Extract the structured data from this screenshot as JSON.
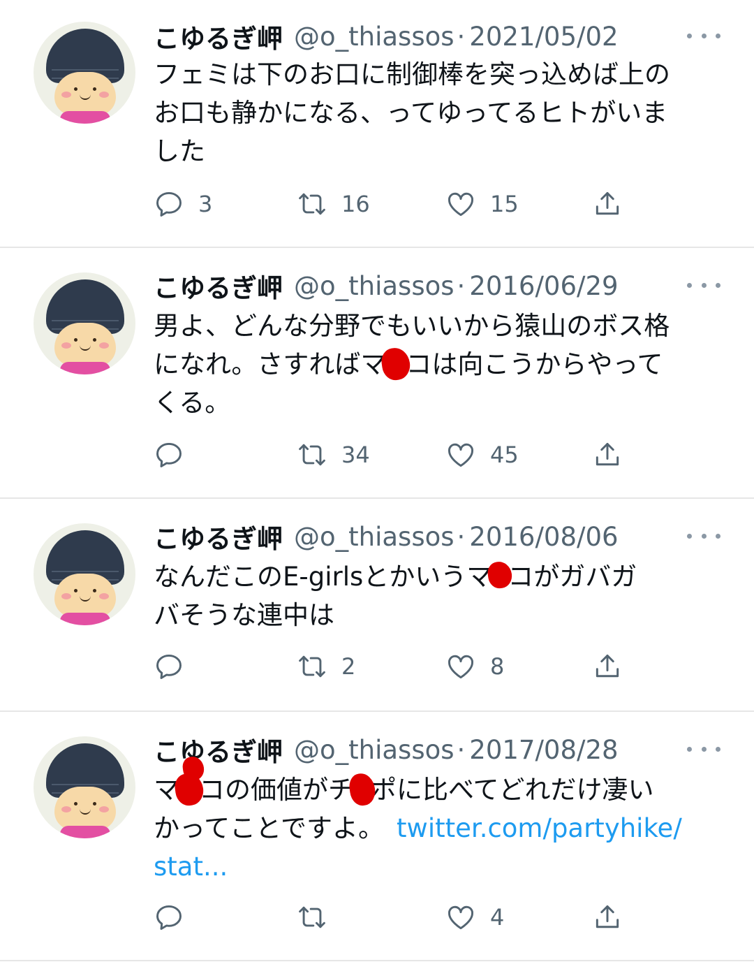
{
  "tweets": [
    {
      "name": "こゆるぎ岬",
      "handle": "@o_thiassos",
      "separator": "·",
      "date": "2021/05/02",
      "text_lines": [
        "フェミは下のお口に制御棒を突っ込めば上の",
        "お口も静かになる、ってゆってるヒトがいま",
        "した"
      ],
      "reply_count": "3",
      "retweet_count": "16",
      "like_count": "15"
    },
    {
      "name": "こゆるぎ岬",
      "handle": "@o_thiassos",
      "separator": "·",
      "date": "2016/06/29",
      "line1": "男よ、どんな分野でもいいから猿山のボス格",
      "line2_a": "になれ。さすればマ",
      "line2_b": "コは向こうからやって",
      "line3": "くる。",
      "reply_count": "",
      "retweet_count": "34",
      "like_count": "45"
    },
    {
      "name": "こゆるぎ岬",
      "handle": "@o_thiassos",
      "separator": "·",
      "date": "2016/08/06",
      "line1_a": "なんだこのE-girlsとかいうマ",
      "line1_b": "コがガバガ",
      "line2": "バそうな連中は",
      "reply_count": "",
      "retweet_count": "2",
      "like_count": "8"
    },
    {
      "name": "こゆるぎ岬",
      "handle": "@o_thiassos",
      "separator": "·",
      "date": "2017/08/28",
      "line1_a": "マ",
      "line1_b": "コの価値がチ",
      "line1_c": "ポに比べてどれだけ凄い",
      "line2_text": "かってことですよ。",
      "link_part1": "twitter.com/partyhike/",
      "link_part2": "stat...",
      "reply_count": "",
      "retweet_count": "",
      "like_count": "4"
    }
  ],
  "colors": {
    "text": "#0f1419",
    "secondary": "#536471",
    "link": "#1d9bf0",
    "redaction": "#e00000"
  },
  "icons": [
    "reply-icon",
    "retweet-icon",
    "like-icon",
    "share-icon",
    "more-icon"
  ]
}
